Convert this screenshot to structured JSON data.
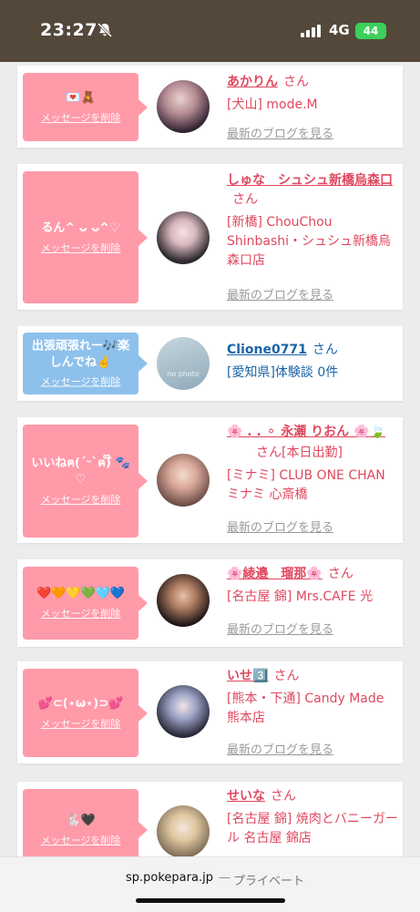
{
  "status": {
    "time": "23:27",
    "network": "4G",
    "battery": "44"
  },
  "items": [
    {
      "message": "💌🧸",
      "delete_label": "メッセージを削除",
      "name": "あかりん",
      "san": "さん",
      "shop": "[犬山] mode.M",
      "blog": "最新のブログを見る"
    },
    {
      "message": "るん^ ᴗ ᴗ^♡",
      "delete_label": "メッセージを削除",
      "name": "しゅな　シュシュ新橋烏森口",
      "san": "さん",
      "shop": "[新橋] ChouChou Shinbashi・シュシュ新橋烏森口店",
      "blog": "最新のブログを見る"
    },
    {
      "message": "出張頑張れー🎶楽しんでね✌️",
      "delete_label": "メッセージを削除",
      "name": "Clione0771",
      "san": "さん",
      "shop": "[愛知県]体験談 0件",
      "avatar_text": "no photo"
    },
    {
      "message": "いいねฅ(ˊᵕˋฅ)໊ 🐾♡",
      "delete_label": "メッセージを削除",
      "name": "🌸 .  . ⚬ 永瀬 りおん 🌸🍃",
      "san": "さん",
      "status_tag": "[本日出勤]",
      "shop": "[ミナミ] CLUB ONE CHAN ミナミ 心斎橋",
      "blog": "最新のブログを見る"
    },
    {
      "message": "❤️🧡💛💚🩵💙",
      "delete_label": "メッセージを削除",
      "name": "🌸綾邉　瑠那🌸",
      "san": "さん",
      "shop": "[名古屋 錦] Mrs.CAFE 光",
      "blog": "最新のブログを見る"
    },
    {
      "message": "💕⊂(⋆ω⋆)⊃💕",
      "delete_label": "メッセージを削除",
      "name": "いせ3️⃣",
      "san": "さん",
      "shop": "[熊本・下通] Candy Made 熊本店",
      "blog": "最新のブログを見る"
    },
    {
      "message": "🐇🖤",
      "delete_label": "メッセージを削除",
      "name": "せいな",
      "san": "さん",
      "shop": "[名古屋 錦] 焼肉とバニーガール 名古屋 錦店"
    }
  ],
  "url_bar": {
    "host": "sp.pokepara.jp",
    "separator": "—",
    "mode": "プライベート"
  }
}
